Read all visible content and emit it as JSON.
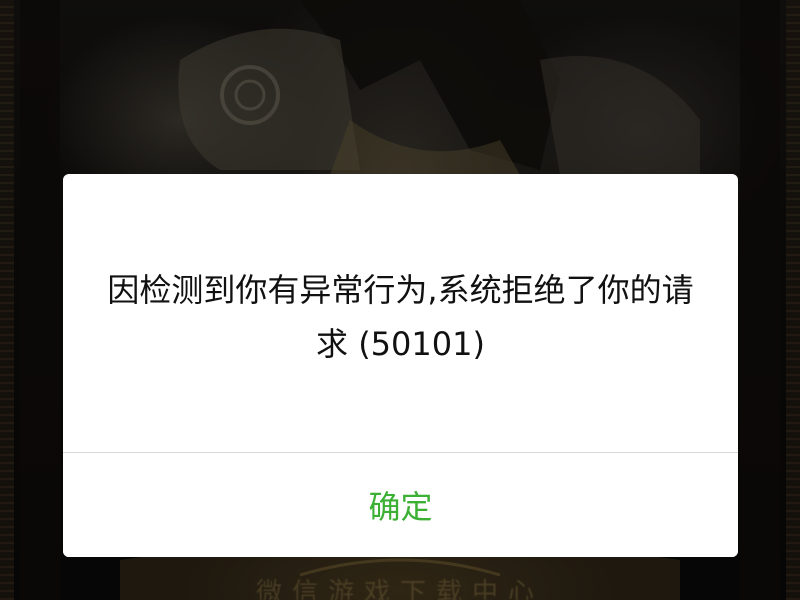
{
  "background": {
    "caption": "微信游戏下载中心"
  },
  "dialog": {
    "message": "因检测到你有异常行为,系统拒绝了你的请求 (50101)",
    "confirm_label": "确定"
  },
  "colors": {
    "confirm_text": "#3cb034",
    "message_text": "#111111",
    "dialog_bg": "#ffffff",
    "overlay": "rgba(0,0,0,0.45)"
  }
}
